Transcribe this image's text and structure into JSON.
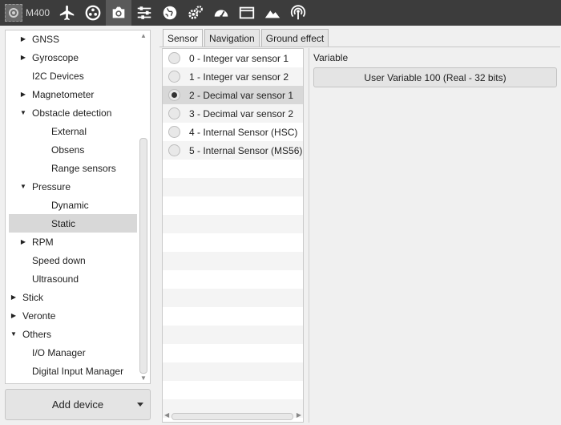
{
  "toolbar": {
    "app_name": "M400",
    "icons": [
      "gear-logo-icon",
      "airplane-icon",
      "spinner-icon",
      "camera-icon",
      "sliders-icon",
      "globe-icon",
      "gears-icon",
      "gauge-icon",
      "window-icon",
      "mountain-icon",
      "signal-icon"
    ],
    "active_index": 3
  },
  "tree": {
    "items": [
      {
        "label": "GNSS",
        "level": 1,
        "arrow": "right"
      },
      {
        "label": "Gyroscope",
        "level": 1,
        "arrow": "right"
      },
      {
        "label": "I2C Devices",
        "level": 1,
        "arrow": ""
      },
      {
        "label": "Magnetometer",
        "level": 1,
        "arrow": "right"
      },
      {
        "label": "Obstacle detection",
        "level": 1,
        "arrow": "down"
      },
      {
        "label": "External",
        "level": 2,
        "arrow": ""
      },
      {
        "label": "Obsens",
        "level": 2,
        "arrow": ""
      },
      {
        "label": "Range sensors",
        "level": 2,
        "arrow": ""
      },
      {
        "label": "Pressure",
        "level": 1,
        "arrow": "down"
      },
      {
        "label": "Dynamic",
        "level": 2,
        "arrow": ""
      },
      {
        "label": "Static",
        "level": 2,
        "arrow": "",
        "selected": true
      },
      {
        "label": "RPM",
        "level": 1,
        "arrow": "right"
      },
      {
        "label": "Speed down",
        "level": 1,
        "arrow": ""
      },
      {
        "label": "Ultrasound",
        "level": 1,
        "arrow": ""
      },
      {
        "label": "Stick",
        "level": 0,
        "arrow": "right"
      },
      {
        "label": "Veronte",
        "level": 0,
        "arrow": "right"
      },
      {
        "label": "Others",
        "level": 0,
        "arrow": "down"
      },
      {
        "label": "I/O Manager",
        "level": 1,
        "arrow": ""
      },
      {
        "label": "Digital Input Manager",
        "level": 1,
        "arrow": ""
      }
    ]
  },
  "add_device_label": "Add device",
  "tabs": [
    {
      "label": "Sensor",
      "active": true
    },
    {
      "label": "Navigation",
      "active": false
    },
    {
      "label": "Ground effect",
      "active": false
    }
  ],
  "sensors": [
    {
      "label": "0 - Integer var sensor 1",
      "checked": false
    },
    {
      "label": "1 - Integer var sensor 2",
      "checked": false
    },
    {
      "label": "2 - Decimal var sensor 1",
      "checked": true
    },
    {
      "label": "3 - Decimal var sensor 2",
      "checked": false
    },
    {
      "label": "4 - Internal Sensor (HSC)",
      "checked": false
    },
    {
      "label": "5 - Internal Sensor (MS56)",
      "checked": false
    }
  ],
  "variable": {
    "label": "Variable",
    "value": "User Variable 100 (Real - 32 bits)"
  }
}
